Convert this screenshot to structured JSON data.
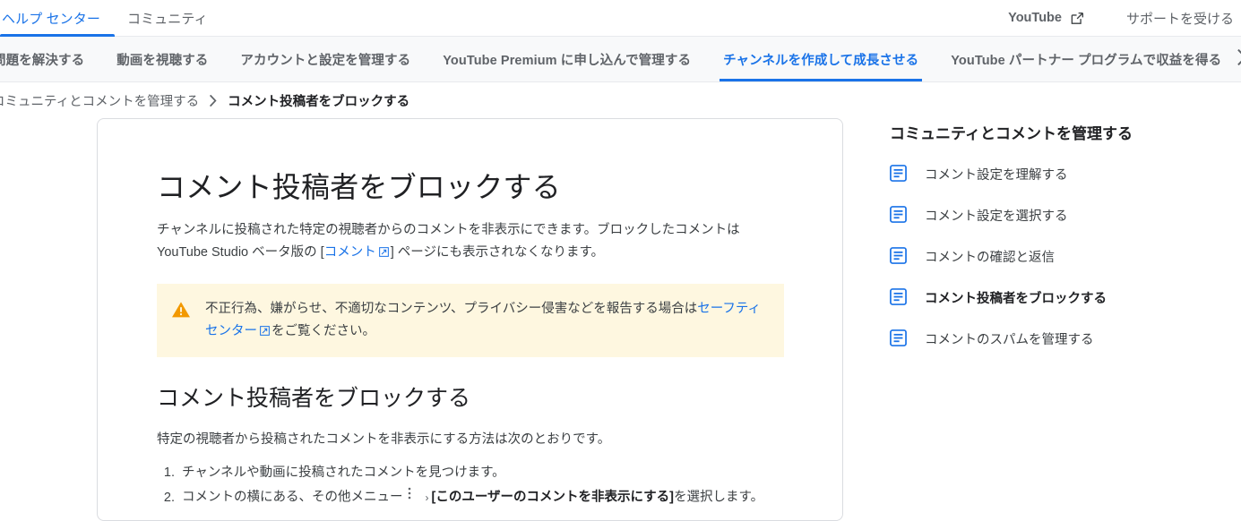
{
  "topbar": {
    "nav": [
      {
        "label": "ヘルプ センター",
        "active": true
      },
      {
        "label": "コミュニティ",
        "active": false
      }
    ],
    "youtube_label": "YouTube",
    "youtube_icon": "external-link-icon",
    "support_label": "サポートを受ける"
  },
  "tabs": {
    "items": [
      {
        "label": "問題を解決する",
        "active": false
      },
      {
        "label": "動画を視聴する",
        "active": false
      },
      {
        "label": "アカウントと設定を管理する",
        "active": false
      },
      {
        "label": "YouTube Premium に申し込んで管理する",
        "active": false
      },
      {
        "label": "チャンネルを作成して成長させる",
        "active": true
      },
      {
        "label": "YouTube パートナー プログラムで収益を得る",
        "active": false
      }
    ],
    "next_icon": "chevron-right-icon"
  },
  "breadcrumb": {
    "parent": "コミュニティとコメントを管理する",
    "separator": "›",
    "current": "コメント投稿者をブロックする"
  },
  "article": {
    "title": "コメント投稿者をブロックする",
    "lead_part1": "チャンネルに投稿された特定の視聴者からのコメントを非表示にできます。ブロックしたコメントは YouTube Studio ベータ版の [",
    "lead_link": "コメント",
    "lead_part2": "] ページにも表示されなくなります。",
    "callout": {
      "icon": "warning-triangle-icon",
      "text_part1": "不正行為、嫌がらせ、不適切なコンテンツ、プライバシー侵害などを報告する場合は",
      "link": "セーフティ センター",
      "text_part2": "をご覧ください。",
      "background": "#fef7e0",
      "icon_color": "#f29900"
    },
    "section_title": "コメント投稿者をブロックする",
    "section_lead": "特定の視聴者から投稿されたコメントを非表示にする方法は次のとおりです。",
    "steps": [
      {
        "text": "チャンネルや動画に投稿されたコメントを見つけます。"
      },
      {
        "prefix": "コメントの横にある、その他メニュー",
        "menu_icon": "more-vertical-icon",
        "chevron": "›",
        "bold": "[このユーザーのコメントを非表示にする]",
        "suffix": "を選択します。"
      }
    ]
  },
  "sidebar": {
    "title": "コミュニティとコメントを管理する",
    "items": [
      {
        "label": "コメント設定を理解する",
        "icon": "article-icon",
        "current": false
      },
      {
        "label": "コメント設定を選択する",
        "icon": "article-icon",
        "current": false
      },
      {
        "label": "コメントの確認と返信",
        "icon": "article-icon",
        "current": false
      },
      {
        "label": "コメント投稿者をブロックする",
        "icon": "article-icon",
        "current": true
      },
      {
        "label": "コメントのスパムを管理する",
        "icon": "article-icon",
        "current": false
      }
    ]
  },
  "colors": {
    "accent": "#1a73e8",
    "text": "#3c4043",
    "heading": "#202124",
    "muted": "#5f6368",
    "border": "#dadce0",
    "tabs_bg": "#f8f9fa"
  }
}
